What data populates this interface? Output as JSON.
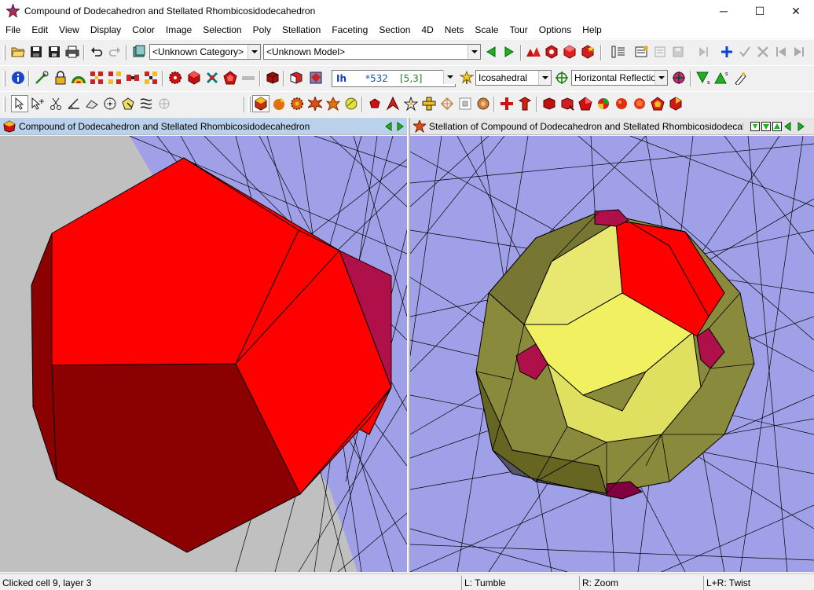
{
  "window": {
    "title": "Compound of Dodecahedron and Stellated Rhombicosidodecahedron",
    "minimize_glyph": "─",
    "maximize_glyph": "☐",
    "close_glyph": "✕"
  },
  "menu": [
    "File",
    "Edit",
    "View",
    "Display",
    "Color",
    "Image",
    "Selection",
    "Poly",
    "Stellation",
    "Faceting",
    "Section",
    "4D",
    "Nets",
    "Scale",
    "Tour",
    "Options",
    "Help"
  ],
  "toolbar1": {
    "category_value": "<Unknown Category>",
    "model_value": "<Unknown Model>"
  },
  "toolbar2": {
    "symmetry_group": "Ih",
    "symmetry_code": "*532",
    "symmetry_schlafli": "[5,3]",
    "symmetry_type": "Icosahedral",
    "reflection_mode": "Horizontal Reflection"
  },
  "left_pane": {
    "title": "Compound of Dodecahedron and Stellated Rhombicosidodecahedron"
  },
  "right_pane": {
    "title": "Stellation of Compound of Dodecahedron and Stellated Rhombicosidodecahedron"
  },
  "status": {
    "message": "Clicked cell 9, layer 3",
    "left_action": "L: Tumble",
    "right_action": "R: Zoom",
    "both_action": "L+R: Twist"
  },
  "colors": {
    "face_red": "#ff0000",
    "face_dark_red": "#8b0000",
    "face_yellow": "#f0f060",
    "face_olive": "#8a8a3c",
    "face_magenta": "#b0104a",
    "background_blue": "#a0a0e8",
    "background_grey": "#c0c0c0"
  }
}
